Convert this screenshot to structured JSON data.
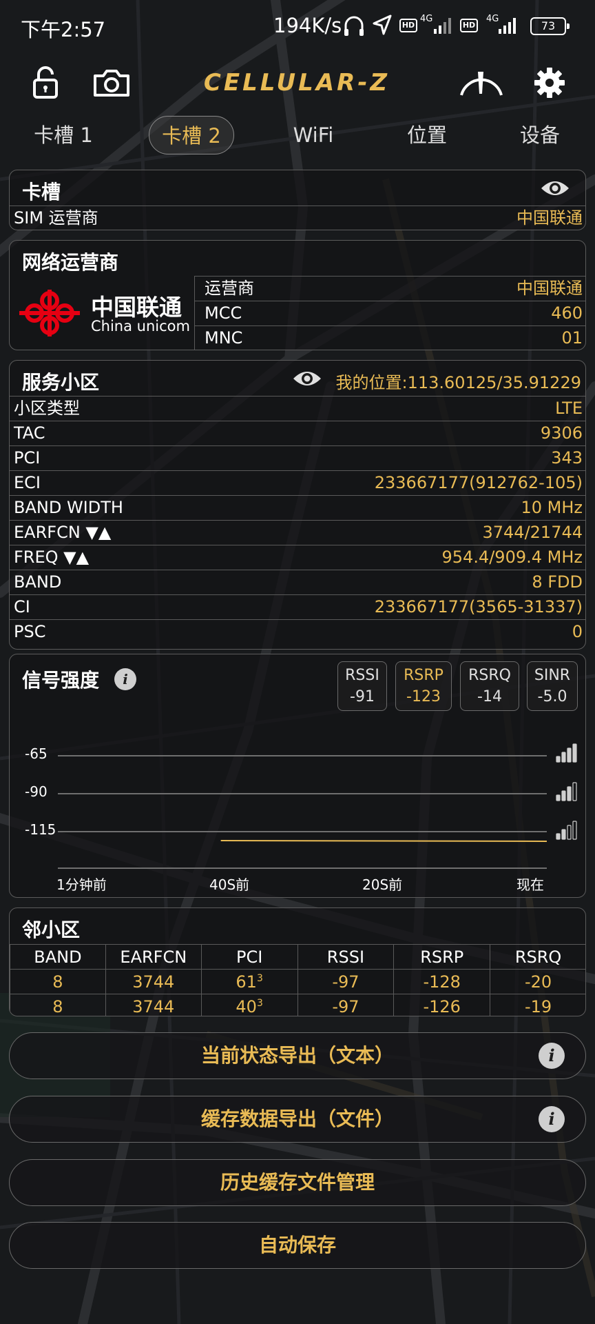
{
  "status_bar": {
    "time": "下午2:57",
    "net_speed": "194K/s",
    "hd1": "HD",
    "net1": "4G",
    "hd2": "HD",
    "net2": "4G",
    "battery": "73"
  },
  "header": {
    "logo": "CELLULAR-Z",
    "icons": [
      "lock-icon",
      "camera-icon",
      "speedometer-icon",
      "gear-icon"
    ]
  },
  "tabs": [
    {
      "label": "卡槽 1",
      "active": false
    },
    {
      "label": "卡槽 2",
      "active": true
    },
    {
      "label": "WiFi",
      "active": false
    },
    {
      "label": "位置",
      "active": false
    },
    {
      "label": "设备",
      "active": false
    }
  ],
  "slot": {
    "title": "卡槽",
    "rows": [
      {
        "k": "SIM 运营商",
        "v": "中国联通"
      }
    ]
  },
  "network": {
    "title": "网络运营商",
    "logo_cn": "中国联通",
    "logo_en": "China unicom",
    "rows": [
      {
        "k": "运营商",
        "v": "中国联通"
      },
      {
        "k": "MCC",
        "v": "460"
      },
      {
        "k": "MNC",
        "v": "01"
      }
    ]
  },
  "cell": {
    "title": "服务小区",
    "location": "我的位置:113.60125/35.91229",
    "rows": [
      {
        "k": "小区类型",
        "v": "LTE"
      },
      {
        "k": "TAC",
        "v": "9306"
      },
      {
        "k": "PCI",
        "v": "343"
      },
      {
        "k": "ECI",
        "v": "233667177(912762-105)"
      },
      {
        "k": "BAND WIDTH",
        "v": "10 MHz"
      },
      {
        "k": "EARFCN ▼▲",
        "v": "3744/21744"
      },
      {
        "k": "FREQ ▼▲",
        "v": "954.4/909.4 MHz"
      },
      {
        "k": "BAND",
        "v": "8 FDD"
      },
      {
        "k": "CI",
        "v": "233667177(3565-31337)"
      },
      {
        "k": "PSC",
        "v": "0"
      }
    ]
  },
  "signal": {
    "title": "信号强度",
    "metrics": [
      {
        "label": "RSSI",
        "value": "-91",
        "selected": false
      },
      {
        "label": "RSRP",
        "value": "-123",
        "selected": true
      },
      {
        "label": "RSRQ",
        "value": "-14",
        "selected": false
      },
      {
        "label": "SINR",
        "value": "-5.0",
        "selected": false
      }
    ]
  },
  "chart_data": {
    "type": "line",
    "title": "",
    "y_ticks": [
      "-65",
      "-90",
      "-115"
    ],
    "x_ticks": [
      "1分钟前",
      "40S前",
      "20S前",
      "现在"
    ],
    "ylim": [
      -140,
      -65
    ],
    "xlim": [
      -60,
      0
    ],
    "series": [
      {
        "x": [
          -40,
          0
        ],
        "y": [
          -120,
          -121
        ],
        "color": "#e9bb55"
      }
    ],
    "grid": true
  },
  "neighbors": {
    "title": "邻小区",
    "columns": [
      "BAND",
      "EARFCN",
      "PCI",
      "RSSI",
      "RSRP",
      "RSRQ"
    ],
    "rows": [
      {
        "band": "8",
        "earfcn": "3744",
        "pci": "61",
        "pci_sup": "3",
        "rssi": "-97",
        "rsrp": "-128",
        "rsrq": "-20"
      },
      {
        "band": "8",
        "earfcn": "3744",
        "pci": "40",
        "pci_sup": "3",
        "rssi": "-97",
        "rsrp": "-126",
        "rsrq": "-19"
      }
    ]
  },
  "buttons": {
    "export_text": "当前状态导出（文本）",
    "export_file": "缓存数据导出（文件）",
    "history": "历史缓存文件管理",
    "autosave": "自动保存",
    "info": "i"
  },
  "colors": {
    "accent": "#e9bb55",
    "panel_border": "#5c5c5c",
    "background": "#16181a"
  }
}
